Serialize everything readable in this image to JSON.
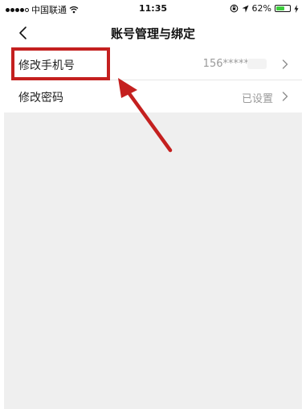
{
  "status_bar": {
    "carrier": "中国联通",
    "time": "11:35",
    "battery_percent": "62%",
    "battery_level": 0.62,
    "icons": [
      "wifi-icon",
      "location-icon",
      "rotation-lock-icon",
      "battery-icon",
      "charging-icon"
    ]
  },
  "nav": {
    "title": "账号管理与绑定",
    "back_icon": "chevron-left-icon"
  },
  "settings": {
    "items": [
      {
        "label": "修改手机号",
        "value": "156*****"
      },
      {
        "label": "修改密码",
        "value": "已设置"
      }
    ]
  },
  "colors": {
    "annotation": "#c4201f",
    "background_gray": "#efefef",
    "value_text": "#9a9a9a"
  }
}
